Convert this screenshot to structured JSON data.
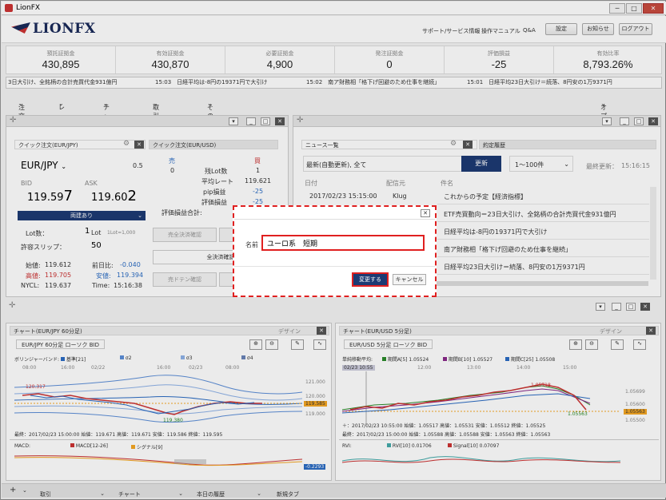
{
  "window": {
    "title": "LionFX"
  },
  "header": {
    "logo": "LIONFX",
    "links": [
      "サポート/サービス情報",
      "操作マニュアル",
      "Q&A"
    ],
    "buttons": [
      "設定",
      "お知らせ",
      "ログアウト"
    ]
  },
  "stats": [
    {
      "label": "預託証拠金",
      "value": "430,895"
    },
    {
      "label": "有効証拠金",
      "value": "430,870"
    },
    {
      "label": "必要証拠金",
      "value": "4,900"
    },
    {
      "label": "発注証拠金",
      "value": "0"
    },
    {
      "label": "評価損益",
      "value": "-25"
    },
    {
      "label": "有効比率",
      "value": "8,793.26%"
    }
  ],
  "ticker": [
    "3日大引け、全銘柄の合計売買代金931億円",
    "15:03　日経平均は-8円の19371円で大引け",
    "15:02　南ア財務相「格下げ回避のため仕事を継続」",
    "15:01　日経平均23日大引け＝続落、8円安の1万9371円"
  ],
  "menu": [
    "注文",
    "レート",
    "チャート",
    "取引情報",
    "その他情報"
  ],
  "menu_right": "オプション取引",
  "quick_order": {
    "tab1": "クイック注文(EUR/JPY)",
    "tab2": "クイック注文(EUR/USD)",
    "pair": "EUR/JPY",
    "spread": "0.5",
    "bid_label": "BID",
    "ask_label": "ASK",
    "bid_main": "119.59",
    "bid_pip": "7",
    "ask_main": "119.60",
    "ask_pip": "2",
    "both_label": "両建あり",
    "lot_label": "Lot数：",
    "lot_value": "1",
    "lot_unit": "Lot",
    "lot_note": "1Lot=1,000",
    "slip_label": "許容スリップ：",
    "slip_value": "50",
    "open_label": "始値:",
    "open_value": "119.612",
    "high_label": "高値:",
    "high_value": "119.705",
    "nycl_label": "NYCL:",
    "nycl_value": "119.637",
    "chg_label": "前日比:",
    "chg_value": "-0.040",
    "low_label": "安値:",
    "low_value": "119.394",
    "time_label": "Time:",
    "time_value": "15:16:38",
    "sell_label": "売",
    "buy_label": "買",
    "sell_count": "0",
    "lot_count_label": "残Lot数",
    "lot_count_value": "1",
    "avg_rate_label": "平均レート",
    "avg_rate_value": "119.621",
    "pip_label": "pip損益",
    "pip_value": "-25",
    "eval_label": "評価損益",
    "eval_value": "-25",
    "eval_total_label": "評価損益合計:",
    "btn_sell_settle": "売全決済確認",
    "btn_all_settle": "全決済確認",
    "btn_sell_dten": "売ドテン確認"
  },
  "news": {
    "tab1": "ニュース一覧",
    "tab2": "約定履歴",
    "filter": "最新(自動更新), 全て",
    "update_btn": "更新",
    "range": "1〜100件",
    "last_update_label": "最終更新：",
    "last_update": "15:16:15",
    "col_date": "日付",
    "col_source": "配信元",
    "col_subject": "件名",
    "first_date": "2017/02/23 15:15:00",
    "first_source": "Klug",
    "rows": [
      "これからの予定【経済指標】",
      "ETF売買動向＝23日大引け、全銘柄の合計売買代金931億円",
      "日経平均は-8円の19371円で大引け",
      "南ア財務相「格下げ回避のため仕事を継続」",
      "日経平均23日大引け＝続落、8円安の1万9371円"
    ]
  },
  "dialog": {
    "name_label": "名前",
    "name_value": "ユーロ系　短期",
    "ok": "変更する",
    "cancel": "キャンセル"
  },
  "chart1": {
    "title": "チャート(EUR/JPY 60分足)",
    "design": "デザイン",
    "symbol": "EUR/JPY 60分足 ローソク BID",
    "legend": "ボリンジャーバンド:",
    "legend_items": [
      "基準[21]",
      "σ2",
      "σ3",
      "σ4"
    ],
    "times": [
      "08:00",
      "16:00",
      "02/22",
      "16:00",
      "02/23",
      "08:00"
    ],
    "prices": [
      "121.000",
      "120.000",
      "119.585",
      "119.000"
    ],
    "hi_label": "120.317",
    "lo_label": "119.380",
    "info": "最終：2017/02/23 15:00:00 始値：119.671 高値：119.671 安値：119.586 終値：119.595",
    "sub": "MACD:",
    "sub_items": [
      "MACD[12-26]",
      "シグナル[9]"
    ],
    "sub_value": "-0.2293"
  },
  "chart2": {
    "title": "チャート(EUR/USD 5分足)",
    "design": "デザイン",
    "symbol": "EUR/USD 5分足 ローソク BID",
    "legend": "単純移動平均:",
    "legend_items": [
      "期間A[5] 1.05524",
      "期間B[10] 1.05527",
      "期間C[25] 1.05508"
    ],
    "times": [
      "02/23 10:55",
      "12:00",
      "13:00",
      "14:00",
      "15:00"
    ],
    "prices": [
      "1.05699",
      "1.05600",
      "1.05563",
      "1.05500"
    ],
    "hi_label": "1.05718",
    "lo_label": "1.05563",
    "info": "＋：2017/02/23 10:55:00 始値：1.05517 高値：1.05531 安値：1.05512 終値：1.05525",
    "info2": "最終：2017/02/23 15:00:00 始値：1.05588 高値：1.05588 安値：1.05563 終値：1.05563",
    "sub": "RVI:",
    "sub_items": [
      "RVI[10] 0.01706",
      "Signal[10] 0.07097"
    ]
  },
  "footer": {
    "tabs": [
      "取引",
      "チャート",
      "本日の履歴",
      "新規タブ"
    ]
  }
}
